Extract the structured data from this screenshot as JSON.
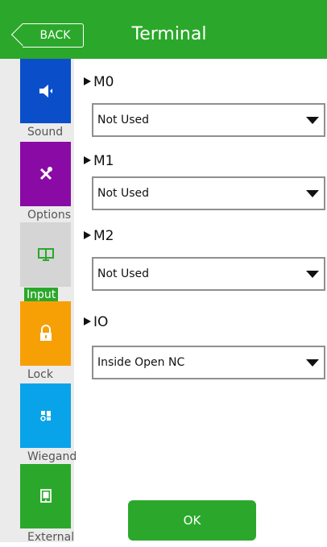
{
  "header": {
    "back_label": "BACK",
    "title": "Terminal"
  },
  "sidebar": {
    "items": [
      {
        "label": "Sound",
        "color": "#0a4fc9",
        "icon": "speaker-icon"
      },
      {
        "label": "Options",
        "color": "#8a0aa5",
        "icon": "tools-icon"
      },
      {
        "label": "Input",
        "color": "#d5d5d5",
        "icon": "monitor-icon",
        "active": true
      },
      {
        "label": "Lock",
        "color": "#f7a006",
        "icon": "lock-icon"
      },
      {
        "label": "Wiegand",
        "color": "#09a3ea",
        "icon": "wiegand-icon"
      },
      {
        "label": "External",
        "color": "#2ba82b",
        "icon": "external-device-icon"
      }
    ]
  },
  "fields": [
    {
      "title": "M0",
      "value": "Not Used"
    },
    {
      "title": "M1",
      "value": "Not Used"
    },
    {
      "title": "M2",
      "value": "Not Used"
    },
    {
      "title": "IO",
      "value": "Inside Open NC"
    }
  ],
  "footer": {
    "ok_label": "OK"
  },
  "colors": {
    "accent": "#2ba82b"
  }
}
